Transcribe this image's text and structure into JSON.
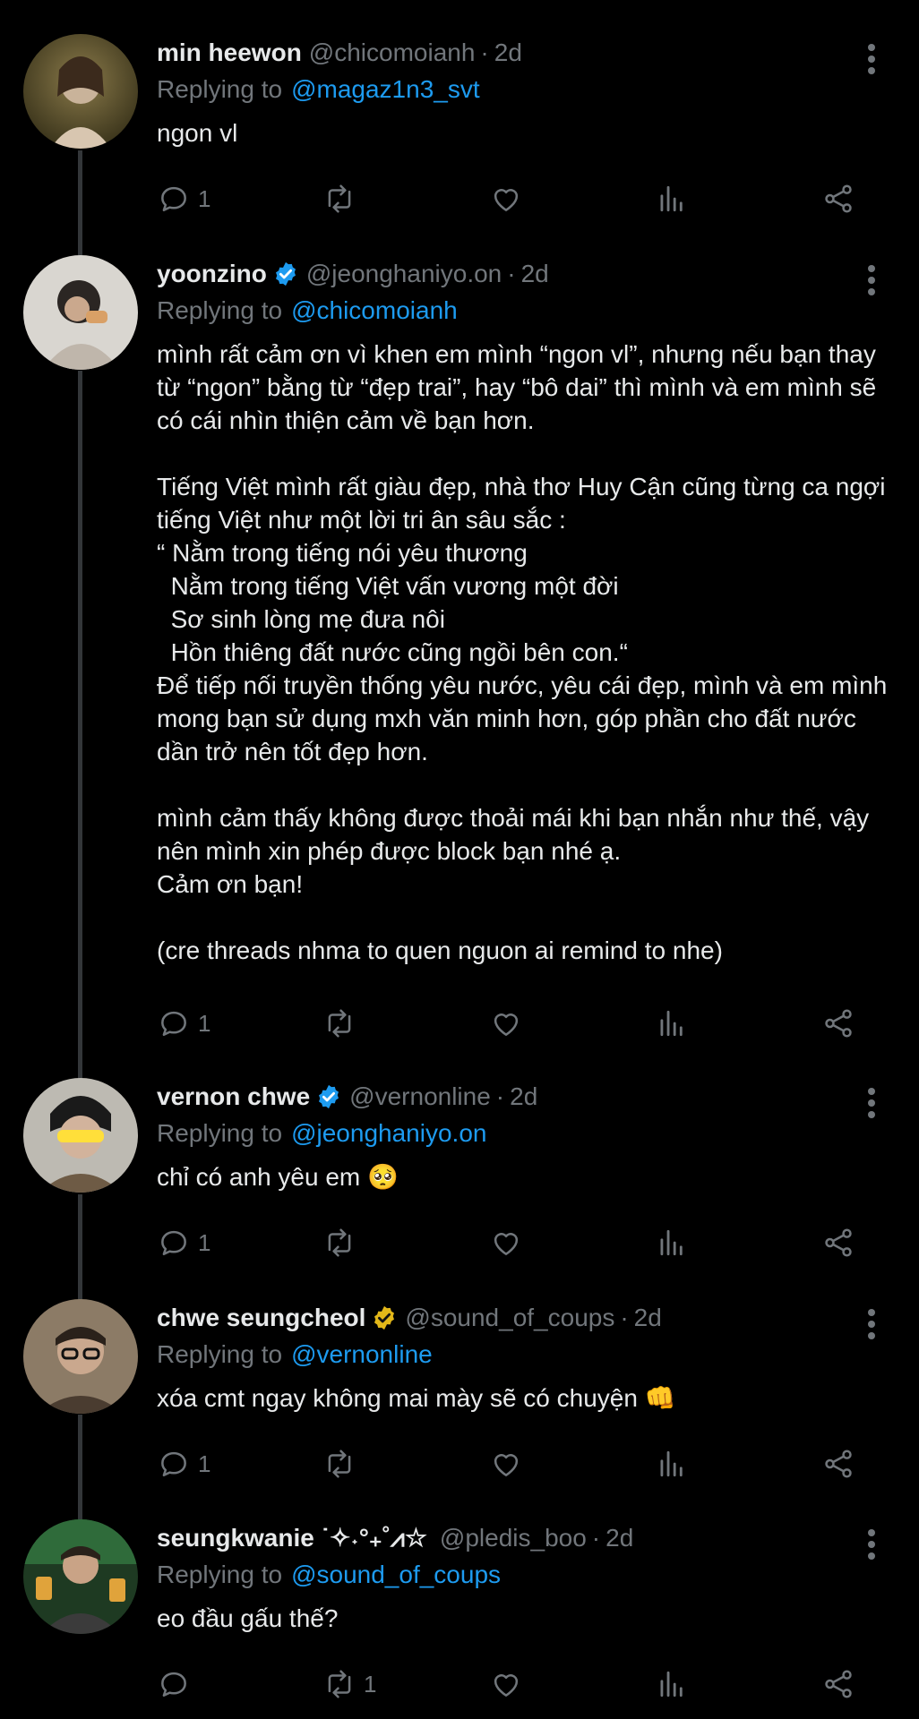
{
  "icons": {
    "reply": "reply-icon",
    "retweet": "retweet-icon",
    "like": "heart-icon",
    "views": "views-icon",
    "share": "share-icon",
    "more": "more-options-icon",
    "verified": "verified-badge-icon"
  },
  "colors": {
    "background": "#000000",
    "text": "#e7e9ea",
    "muted": "#71767b",
    "link": "#1d9bf0",
    "verified_blue": "#1d9bf0",
    "verified_gold": "#e2b719"
  },
  "reply_prefix": "Replying to",
  "separator": "·",
  "tweets": [
    {
      "name": "min heewon",
      "handle": "@chicomoianh",
      "time": "2d",
      "replying_to": "@magaz1n3_svt",
      "text": "ngon vl",
      "reply_count": "1",
      "retweet_count": "",
      "verified": "none"
    },
    {
      "name": "yoonzino",
      "handle": "@jeonghaniyo.on",
      "time": "2d",
      "replying_to": "@chicomoianh",
      "text": "mình rất cảm ơn vì khen em mình “ngon vl”, nhưng nếu bạn thay từ “ngon” bằng từ “đẹp trai”, hay “bô dai” thì mình và em mình sẽ có cái nhìn thiện cảm về bạn hơn.\n\nTiếng Việt mình rất giàu đẹp, nhà thơ Huy Cận cũng từng ca ngợi tiếng Việt như một lời tri ân sâu sắc :\n“ Nằm trong tiếng nói yêu thương\n  Nằm trong tiếng Việt vấn vương một đời\n  Sơ sinh lòng mẹ đưa nôi\n  Hồn thiêng đất nước cũng ngồi bên con.“\nĐể tiếp nối truyền thống yêu nước, yêu cái đẹp, mình và em mình mong bạn sử dụng mxh văn minh hơn, góp phần cho đất nước dần trở nên tốt đẹp hơn.\n\nmình cảm thấy không được thoải mái khi bạn nhắn như thế, vậy nên mình xin phép được block bạn nhé ạ.\nCảm ơn bạn!\n\n(cre threads nhma to quen nguon ai remind to nhe)",
      "reply_count": "1",
      "retweet_count": "",
      "verified": "blue"
    },
    {
      "name": "vernon chwe",
      "handle": "@vernonline",
      "time": "2d",
      "replying_to": "@jeonghaniyo.on",
      "text": "chỉ có anh yêu em 🥺",
      "reply_count": "1",
      "retweet_count": "",
      "verified": "blue"
    },
    {
      "name": "chwe seungcheol",
      "handle": "@sound_of_coups",
      "time": "2d",
      "replying_to": "@vernonline",
      "text": "xóa cmt ngay không mai mày sẽ có chuyện 👊",
      "reply_count": "1",
      "retweet_count": "",
      "verified": "gold"
    },
    {
      "name": "seungkwanie ˙✧˖°₊˚⩘☆",
      "handle": "@pledis_boo",
      "time": "2d",
      "replying_to": "@sound_of_coups",
      "text": "eo đầu gấu thế?",
      "reply_count": "",
      "retweet_count": "1",
      "verified": "none"
    }
  ]
}
